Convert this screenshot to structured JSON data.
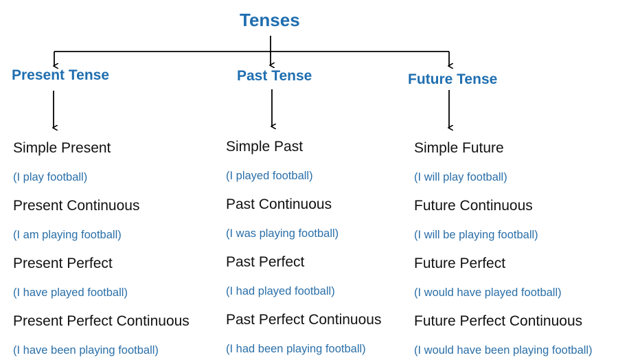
{
  "title": "Tenses",
  "colors": {
    "heading": "#1f6eb0",
    "example": "#2a6fa8",
    "text": "#111111",
    "arrow": "#000000"
  },
  "branches": [
    {
      "label": "Present Tense",
      "items": [
        {
          "name": "Simple Present",
          "example": "(I play football)"
        },
        {
          "name": "Present Continuous",
          "example": "(I am playing football)"
        },
        {
          "name": "Present Perfect",
          "example": "(I have played football)"
        },
        {
          "name": "Present Perfect Continuous",
          "example": "(I have been playing football)"
        }
      ]
    },
    {
      "label": "Past Tense",
      "items": [
        {
          "name": "Simple Past",
          "example": "(I played football)"
        },
        {
          "name": "Past Continuous",
          "example": "(I was playing football)"
        },
        {
          "name": "Past Perfect",
          "example": "(I had played football)"
        },
        {
          "name": "Past Perfect Continuous",
          "example": "(I had been playing football)"
        }
      ]
    },
    {
      "label": "Future Tense",
      "items": [
        {
          "name": "Simple Future",
          "example": "(I will play football)"
        },
        {
          "name": "Future Continuous",
          "example": "(I will be playing football)"
        },
        {
          "name": "Future Perfect",
          "example": "(I would have played football)"
        },
        {
          "name": "Future Perfect Continuous",
          "example": "(I would have been playing football)"
        }
      ]
    }
  ]
}
